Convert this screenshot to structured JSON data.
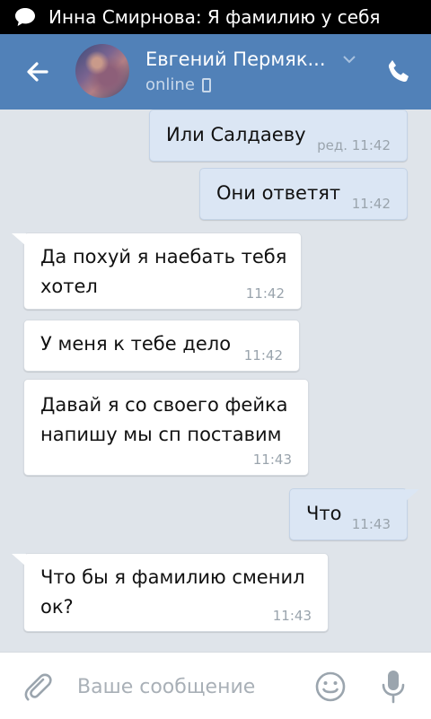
{
  "status_bar": {
    "notification": "Инна Смирнова: Я фамилию у себя"
  },
  "header": {
    "contact_name": "Евгений Пермяк...",
    "status": "online"
  },
  "messages": [
    {
      "direction": "out",
      "text": "Или Салдаеву",
      "edited_label": "ред.",
      "time": "11:42"
    },
    {
      "direction": "out",
      "text": "Они ответят",
      "time": "11:42"
    },
    {
      "direction": "in",
      "line1": "Да похуй я наебать тебя",
      "line2": "хотел",
      "time": "11:42"
    },
    {
      "direction": "in",
      "text": "У меня к тебе дело",
      "time": "11:42"
    },
    {
      "direction": "in",
      "line1": "Давай я со своего фейка",
      "line2": "напишу мы сп поставим",
      "time": "11:43"
    },
    {
      "direction": "out",
      "text": "Что",
      "time": "11:43"
    },
    {
      "direction": "in",
      "line1": "Что бы я фамилию сменил",
      "line2": "ок?",
      "time": "11:43"
    }
  ],
  "composer": {
    "placeholder": "Ваше сообщение"
  },
  "colors": {
    "header": "#5181b8",
    "chat_background": "#dfe4ea",
    "outgoing_bubble": "#dbe6f4",
    "incoming_bubble": "#ffffff"
  },
  "icons": [
    "message-icon",
    "back-arrow-icon",
    "chevron-down-icon",
    "mobile-phone-icon",
    "phone-call-icon",
    "paperclip-icon",
    "smiley-icon",
    "microphone-icon"
  ]
}
